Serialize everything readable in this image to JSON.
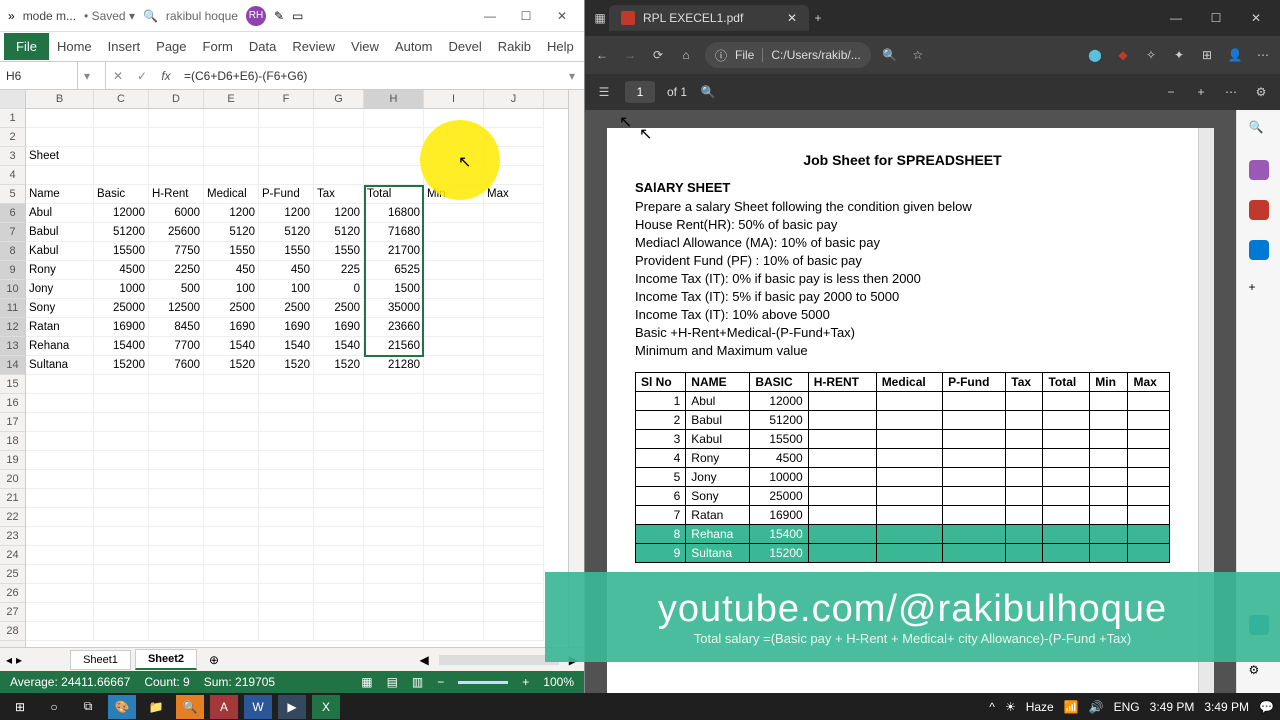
{
  "excel": {
    "doc_name": "mode m...",
    "saved_dropdown": "• Saved ▾",
    "user_name": "rakibul hoque",
    "user_initials": "RH",
    "ribbon": {
      "file": "File",
      "home": "Home",
      "insert": "Insert",
      "page": "Page",
      "form": "Form",
      "data": "Data",
      "review": "Review",
      "view": "View",
      "auto": "Autom",
      "devel": "Devel",
      "rakib": "Rakib",
      "help": "Help"
    },
    "name_box": "H6",
    "formula": "=(C6+D6+E6)-(F6+G6)",
    "columns": [
      "B",
      "C",
      "D",
      "E",
      "F",
      "G",
      "H",
      "I",
      "J"
    ],
    "row3_label": "Sheet",
    "headers": {
      "name": "Name",
      "basic": "Basic",
      "hrent": "H-Rent",
      "medical": "Medical",
      "pfund": "P-Fund",
      "tax": "Tax",
      "total": "Total",
      "min": "Min",
      "max": "Max"
    },
    "rows": [
      {
        "n": 6,
        "name": "Abul",
        "basic": 12000,
        "hrent": 6000,
        "med": 1200,
        "pf": 1200,
        "tax": 1200,
        "total": 16800
      },
      {
        "n": 7,
        "name": "Babul",
        "basic": 51200,
        "hrent": 25600,
        "med": 5120,
        "pf": 5120,
        "tax": 5120,
        "total": 71680
      },
      {
        "n": 8,
        "name": "Kabul",
        "basic": 15500,
        "hrent": 7750,
        "med": 1550,
        "pf": 1550,
        "tax": 1550,
        "total": 21700
      },
      {
        "n": 9,
        "name": "Rony",
        "basic": 4500,
        "hrent": 2250,
        "med": 450,
        "pf": 450,
        "tax": 225,
        "total": 6525
      },
      {
        "n": 10,
        "name": "Jony",
        "basic": 1000,
        "hrent": 500,
        "med": 100,
        "pf": 100,
        "tax": 0,
        "total": 1500
      },
      {
        "n": 11,
        "name": "Sony",
        "basic": 25000,
        "hrent": 12500,
        "med": 2500,
        "pf": 2500,
        "tax": 2500,
        "total": 35000
      },
      {
        "n": 12,
        "name": "Ratan",
        "basic": 16900,
        "hrent": 8450,
        "med": 1690,
        "pf": 1690,
        "tax": 1690,
        "total": 23660
      },
      {
        "n": 13,
        "name": "Rehana",
        "basic": 15400,
        "hrent": 7700,
        "med": 1540,
        "pf": 1540,
        "tax": 1540,
        "total": 21560
      },
      {
        "n": 14,
        "name": "Sultana",
        "basic": 15200,
        "hrent": 7600,
        "med": 1520,
        "pf": 1520,
        "tax": 1520,
        "total": 21280
      }
    ],
    "sheets": {
      "s1": "Sheet1",
      "s2": "Sheet2"
    },
    "status": {
      "avg": "Average: 24411.66667",
      "count": "Count: 9",
      "sum": "Sum: 219705",
      "zoom": "100%"
    }
  },
  "edge": {
    "tab_title": "RPL EXECEL1.pdf",
    "url_label": "File",
    "url_path": "C:/Users/rakib/...",
    "page_current": "1",
    "page_total": "of 1"
  },
  "pdf": {
    "title": "Job Sheet for SPREADSHEET",
    "subhead": "SAlARY SHEET",
    "lines": [
      "Prepare a salary Sheet following the condition given below",
      "House Rent(HR): 50% of basic pay",
      "Mediacl Allowance (MA): 10% of basic pay",
      "Provident Fund (PF) : 10% of basic pay",
      "Income Tax (IT): 0% if basic pay is less then 2000",
      "Income Tax (IT): 5% if basic pay 2000 to 5000",
      "Income Tax (IT): 10% above 5000",
      "Basic +H-Rent+Medical-(P-Fund+Tax)",
      "Minimum and Maximum value"
    ],
    "th": {
      "sl": "Sl No",
      "name": "NAME",
      "basic": "BASIC",
      "hrent": "H-RENT",
      "med": "Medical",
      "pf": "P-Fund",
      "tax": "Tax",
      "total": "Total",
      "min": "Min",
      "max": "Max"
    },
    "tr": [
      {
        "sl": 1,
        "name": "Abul",
        "basic": 12000
      },
      {
        "sl": 2,
        "name": "Babul",
        "basic": 51200
      },
      {
        "sl": 3,
        "name": "Kabul",
        "basic": 15500
      },
      {
        "sl": 4,
        "name": "Rony",
        "basic": 4500
      },
      {
        "sl": 5,
        "name": "Jony",
        "basic": 10000
      },
      {
        "sl": 6,
        "name": "Sony",
        "basic": 25000
      },
      {
        "sl": 7,
        "name": "Ratan",
        "basic": 16900
      },
      {
        "sl": 8,
        "name": "Rehana",
        "basic": 15400,
        "hl": true
      },
      {
        "sl": 9,
        "name": "Sultana",
        "basic": 15200,
        "hl": true
      }
    ],
    "formula_note": "Total salary =(Basic pay + H-Rent + Medical+ city Allowance)-(P-Fund +Tax)"
  },
  "overlay": {
    "big": "youtube.com/@rakibulhoque"
  },
  "taskbar": {
    "weather": "Haze",
    "lang": "ENG",
    "time": "3:49 PM",
    "date": "3:49 PM",
    "net": "📶",
    "vol": "🔊",
    "up": "^"
  },
  "chart_data": {
    "type": "table",
    "title": "Salary Sheet",
    "columns": [
      "Name",
      "Basic",
      "H-Rent",
      "Medical",
      "P-Fund",
      "Tax",
      "Total"
    ],
    "rows": [
      [
        "Abul",
        12000,
        6000,
        1200,
        1200,
        1200,
        16800
      ],
      [
        "Babul",
        51200,
        25600,
        5120,
        5120,
        5120,
        71680
      ],
      [
        "Kabul",
        15500,
        7750,
        1550,
        1550,
        1550,
        21700
      ],
      [
        "Rony",
        4500,
        2250,
        450,
        450,
        225,
        6525
      ],
      [
        "Jony",
        1000,
        500,
        100,
        100,
        0,
        1500
      ],
      [
        "Sony",
        25000,
        12500,
        2500,
        2500,
        2500,
        35000
      ],
      [
        "Ratan",
        16900,
        8450,
        1690,
        1690,
        1690,
        23660
      ],
      [
        "Rehana",
        15400,
        7700,
        1540,
        1540,
        1540,
        21560
      ],
      [
        "Sultana",
        15200,
        7600,
        1520,
        1520,
        1520,
        21280
      ]
    ]
  }
}
